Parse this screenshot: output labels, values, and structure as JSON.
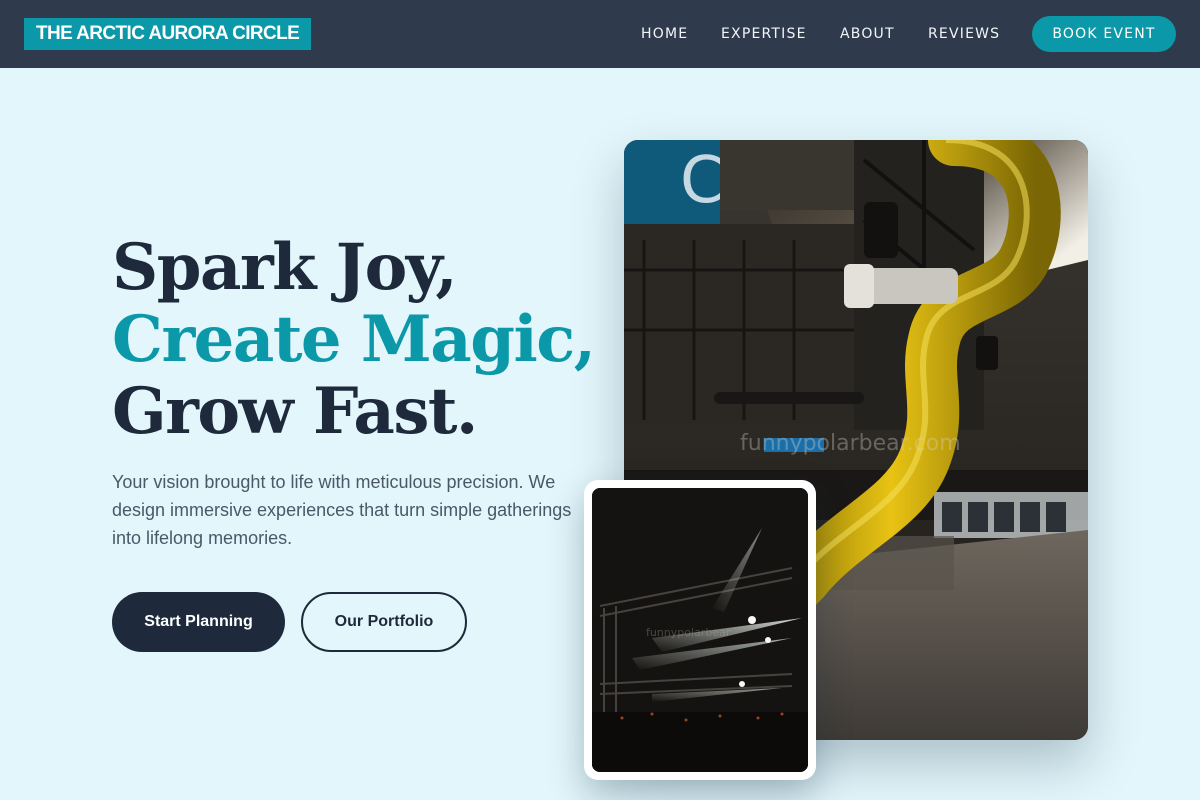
{
  "brand": {
    "name": "THE ARCTIC AURORA CIRCLE"
  },
  "nav": {
    "links": [
      "HOME",
      "EXPERTISE",
      "ABOUT",
      "REVIEWS"
    ],
    "cta": "BOOK EVENT"
  },
  "hero": {
    "line1": "Spark Joy,",
    "line2": "Create Magic,",
    "line3": "Grow Fast.",
    "subtext": "Your vision brought to life with meticulous precision. We design immersive experiences that turn simple gatherings into lifelong memories.",
    "primary_button": "Start Planning",
    "secondary_button": "Our Portfolio"
  },
  "images": {
    "main": {
      "sign_letter": "C",
      "watermark": "funnypolarbear.com"
    },
    "inset": {
      "watermark": "funnypolarbear"
    }
  },
  "colors": {
    "accent": "#0b98a8",
    "navy": "#1e293b",
    "nav_bg": "#2f3b4c",
    "page_bg": "#e2f6fb"
  }
}
